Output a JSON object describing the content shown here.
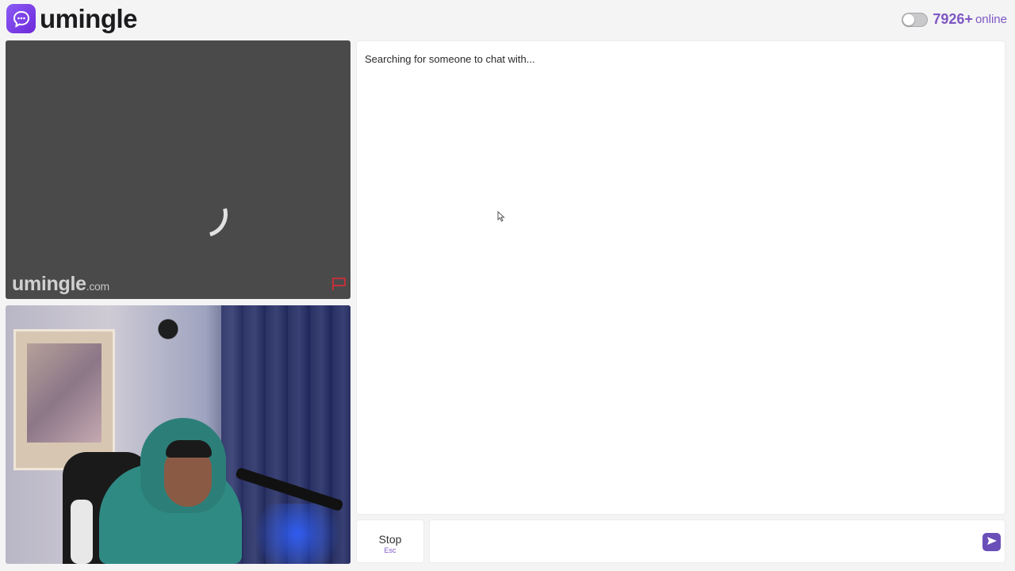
{
  "header": {
    "logo_text": "umingle",
    "online_count": "7926+",
    "online_label": "online"
  },
  "remote_video": {
    "watermark_main": "umingle",
    "watermark_suffix": ".com"
  },
  "chat": {
    "status": "Searching for someone to chat with..."
  },
  "controls": {
    "stop_label": "Stop",
    "stop_shortcut": "Esc",
    "message_placeholder": ""
  },
  "colors": {
    "accent": "#7e57c2",
    "logo_gradient_start": "#8b5cf6",
    "logo_gradient_end": "#6d28d9",
    "video_background": "#4a4a4a",
    "report_flag": "#c0303a"
  },
  "icons": {
    "logo": "chat-bubble-icon",
    "report": "flag-icon",
    "send": "send-arrow-icon"
  }
}
